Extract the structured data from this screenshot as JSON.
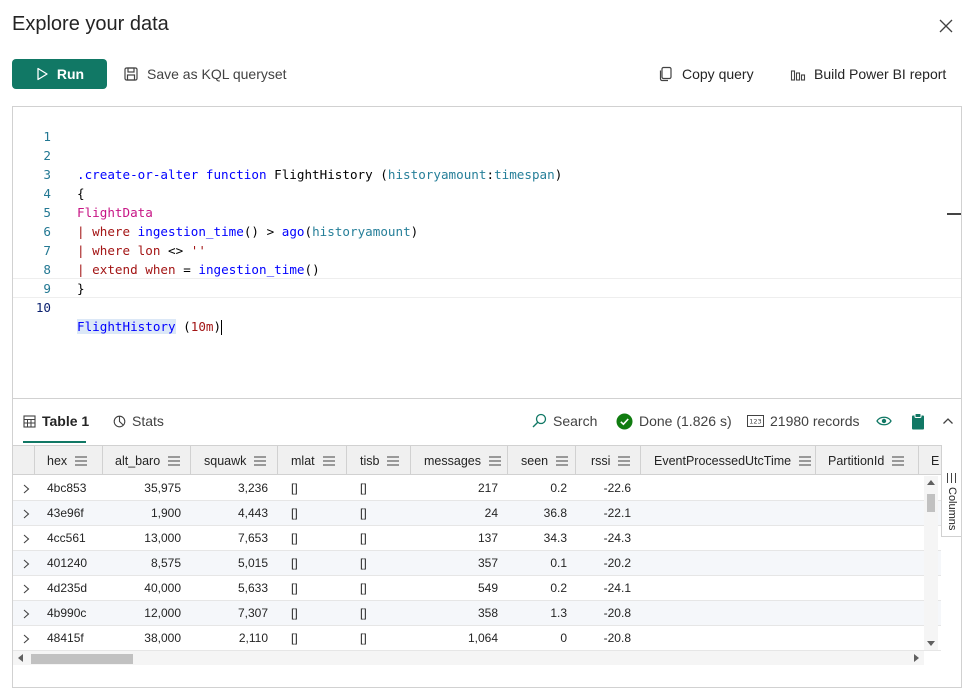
{
  "dialog": {
    "title": "Explore your data",
    "close_icon": "close-icon"
  },
  "toolbar": {
    "run_label": "Run",
    "save_label": "Save as KQL queryset",
    "copy_label": "Copy query",
    "pbi_label": "Build Power BI report",
    "run_color": "#117865"
  },
  "editor": {
    "line_numbers": [
      "1",
      "2",
      "3",
      "4",
      "5",
      "6",
      "7",
      "8",
      "9",
      "10"
    ],
    "lines": [
      "",
      ".create-or-alter function FlightHistory (historyamount:timespan)",
      "{",
      "FlightData",
      "| where ingestion_time() > ago(historyamount)",
      "| where lon <> ''",
      "| extend when = ingestion_time()",
      "}",
      "",
      "FlightHistory (10m)"
    ],
    "active_line": 10
  },
  "results": {
    "tabs": [
      "Table 1",
      "Stats"
    ],
    "search_label": "Search",
    "status": "Done (1.826 s)",
    "records": "21980 records",
    "side_panel_label": "Columns",
    "columns": [
      "hex",
      "alt_baro",
      "squawk",
      "mlat",
      "tisb",
      "messages",
      "seen",
      "rssi",
      "EventProcessedUtcTime",
      "PartitionId",
      "E"
    ],
    "rows": [
      [
        "4bc853",
        "35,975",
        "3,236",
        "[]",
        "[]",
        "217",
        "0.2",
        "-22.6"
      ],
      [
        "43e96f",
        "1,900",
        "4,443",
        "[]",
        "[]",
        "24",
        "36.8",
        "-22.1"
      ],
      [
        "4cc561",
        "13,000",
        "7,653",
        "[]",
        "[]",
        "137",
        "34.3",
        "-24.3"
      ],
      [
        "401240",
        "8,575",
        "5,015",
        "[]",
        "[]",
        "357",
        "0.1",
        "-20.2"
      ],
      [
        "4d235d",
        "40,000",
        "5,633",
        "[]",
        "[]",
        "549",
        "0.2",
        "-24.1"
      ],
      [
        "4b990c",
        "12,000",
        "7,307",
        "[]",
        "[]",
        "358",
        "1.3",
        "-20.8"
      ],
      [
        "48415f",
        "38,000",
        "2,110",
        "[]",
        "[]",
        "1,064",
        "0",
        "-20.8"
      ]
    ]
  }
}
